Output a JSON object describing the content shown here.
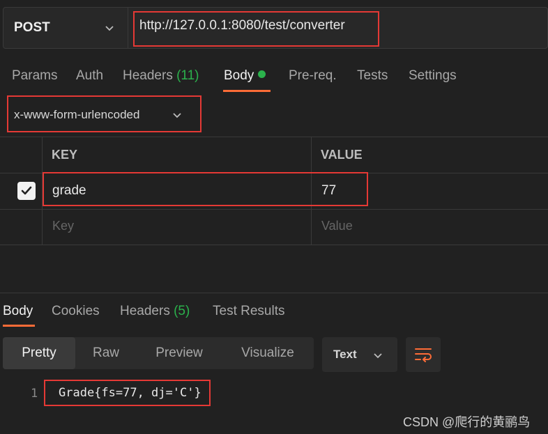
{
  "request": {
    "method": "POST",
    "url": "http://127.0.0.1:8080/test/converter"
  },
  "request_tabs": [
    {
      "label": "Params"
    },
    {
      "label": "Auth"
    },
    {
      "label": "Headers",
      "count": "(11)"
    },
    {
      "label": "Body"
    },
    {
      "label": "Pre-req."
    },
    {
      "label": "Tests"
    },
    {
      "label": "Settings"
    }
  ],
  "body_mode": "x-www-form-urlencoded",
  "params_table": {
    "headers": [
      "KEY",
      "VALUE"
    ],
    "rows": [
      {
        "key": "grade",
        "value": "77",
        "checked": true
      }
    ],
    "placeholder_key": "Key",
    "placeholder_value": "Value"
  },
  "response_tabs": [
    {
      "label": "Body"
    },
    {
      "label": "Cookies"
    },
    {
      "label": "Headers",
      "count": "(5)"
    },
    {
      "label": "Test Results"
    }
  ],
  "view_modes": [
    "Pretty",
    "Raw",
    "Preview",
    "Visualize"
  ],
  "format": "Text",
  "response_body": {
    "line_number": "1",
    "line": "Grade{fs=77, dj='C'}"
  },
  "watermark": "CSDN @爬行的黄鹂鸟",
  "colors": {
    "accent": "#ff6c37",
    "green": "#2bb24c",
    "highlight": "#e53935"
  }
}
